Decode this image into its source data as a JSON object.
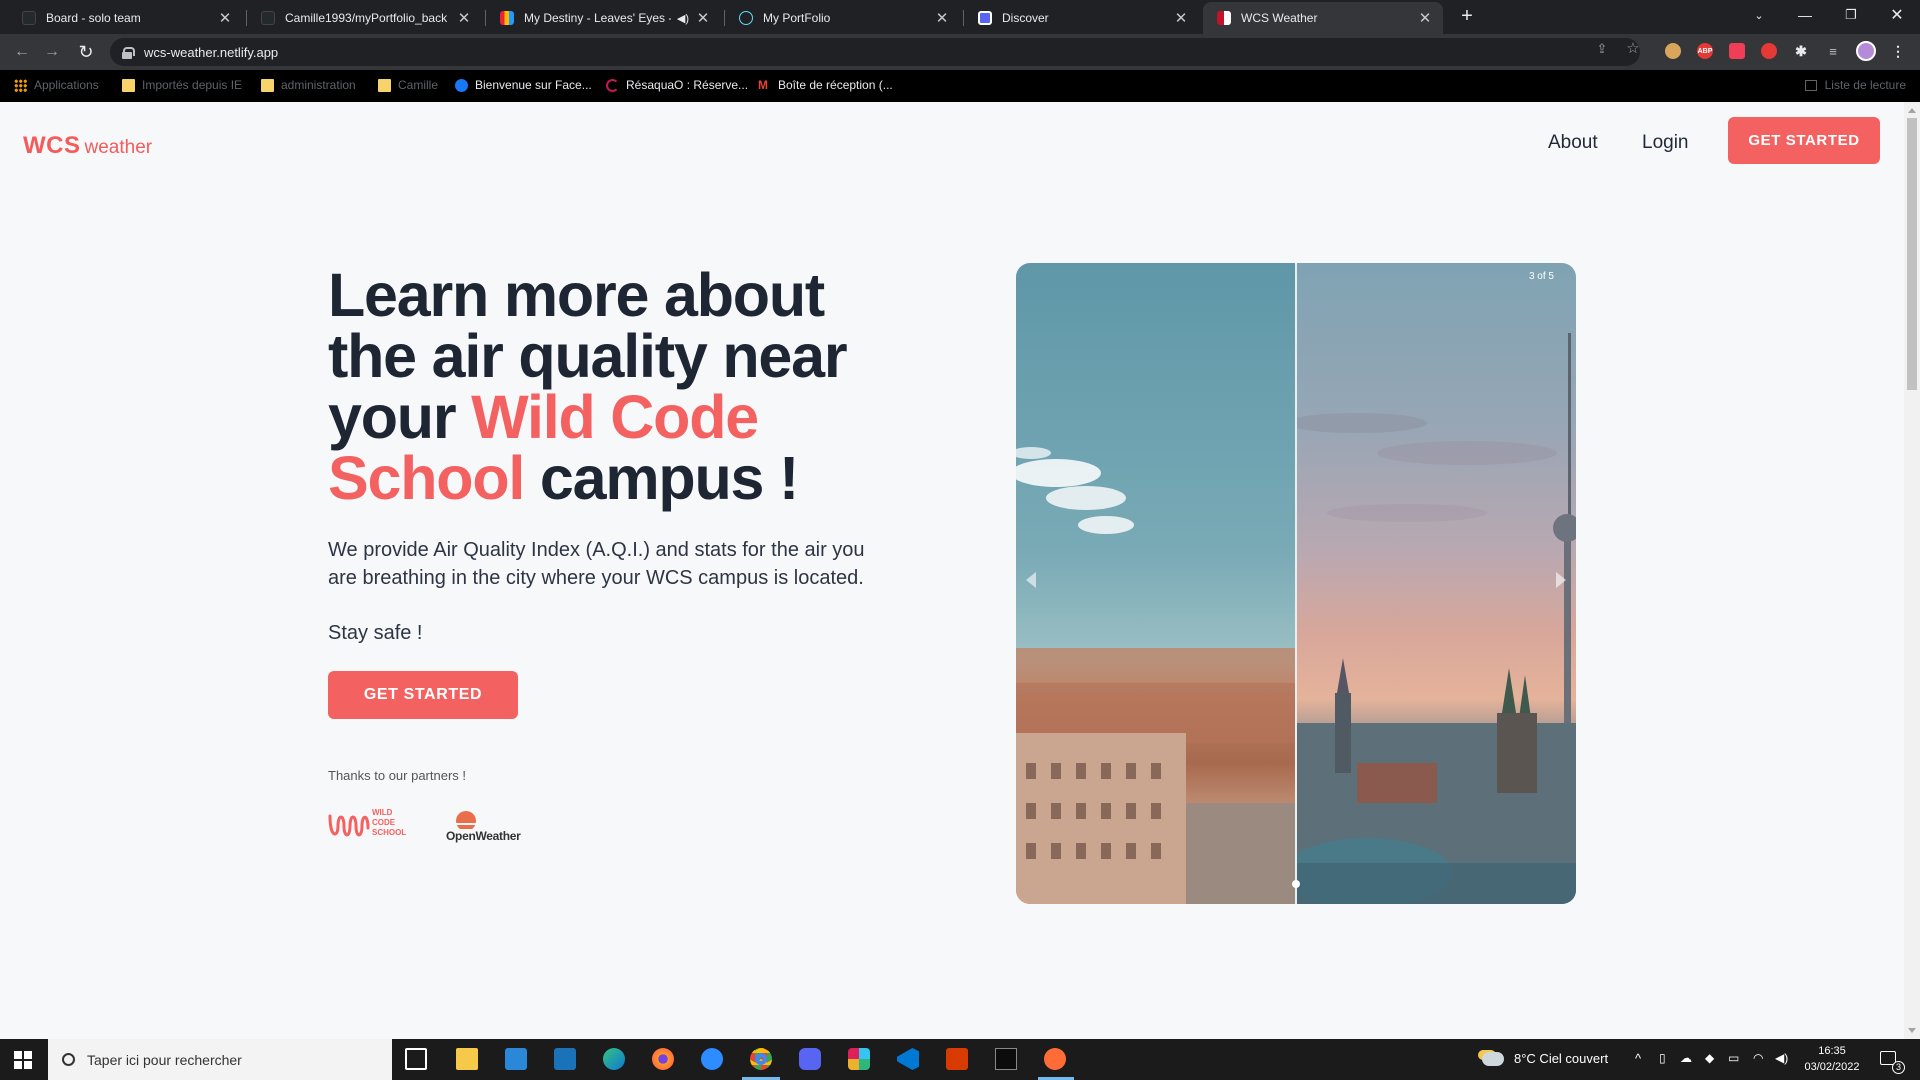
{
  "browser": {
    "tabs": [
      {
        "title": "Board - solo team",
        "close": "✕"
      },
      {
        "title": "Camille1993/myPortfolio_back",
        "close": "✕"
      },
      {
        "title": "My Destiny - Leaves' Eyes - D",
        "close": "✕"
      },
      {
        "title": "My PortFolio",
        "close": "✕"
      },
      {
        "title": "Discover",
        "close": "✕"
      },
      {
        "title": "WCS Weather",
        "close": "✕"
      }
    ],
    "new_tab": "+",
    "url": "wcs-weather.netlify.app",
    "bookmarks": [
      {
        "label": "Applications"
      },
      {
        "label": "Importés depuis IE"
      },
      {
        "label": "administration"
      },
      {
        "label": "Camille"
      },
      {
        "label": "Bienvenue sur Face..."
      },
      {
        "label": "RésaquaO : Réserve..."
      },
      {
        "label": "Boîte de réception (..."
      }
    ],
    "reading_list": "Liste de lecture",
    "extensions": {
      "abp": "ABP"
    }
  },
  "site": {
    "logo_main": "WCS",
    "logo_sub": "weather",
    "nav": {
      "about": "About",
      "login": "Login",
      "get_started": "GET STARTED"
    },
    "hero": {
      "title_part1": "Learn more about the air quality near your ",
      "title_accent": "Wild Code School",
      "title_part2": " campus !",
      "description": "We provide Air Quality Index (A.Q.I.) and stats for the air you are breathing in the city where your WCS campus is located.",
      "stay_safe": "Stay safe !",
      "cta": "GET STARTED",
      "partners_label": "Thanks to our partners !",
      "partner_wcs_lines": [
        "WILD",
        "CODE",
        "SCHOOL"
      ],
      "partner_ow": "OpenWeather"
    },
    "carousel": {
      "counter": "3 of 5"
    }
  },
  "taskbar": {
    "search_placeholder": "Taper ici pour rechercher",
    "weather": "8°C  Ciel couvert",
    "time": "16:35",
    "date": "03/02/2022",
    "notification_count": "3"
  },
  "colors": {
    "accent": "#f46161",
    "dark_text": "#1e2533"
  }
}
